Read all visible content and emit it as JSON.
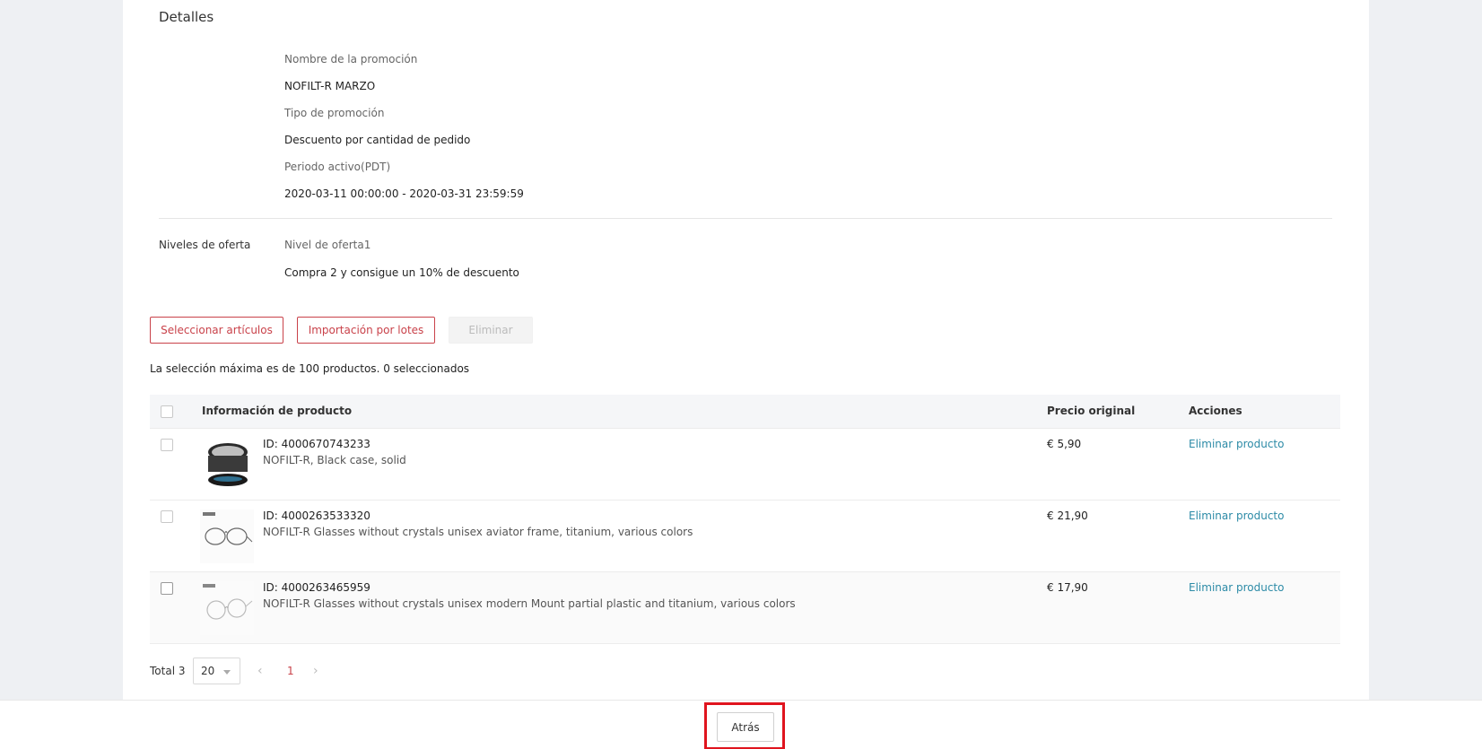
{
  "details": {
    "title": "Detalles",
    "promo_name_label": "Nombre de la promoción",
    "promo_name": "NOFILT-R MARZO",
    "promo_type_label": "Tipo de promoción",
    "promo_type": "Descuento por cantidad de pedido",
    "period_label": "Periodo activo(PDT)",
    "period": "2020-03-11 00:00:00 - 2020-03-31 23:59:59",
    "levels_label": "Niveles de oferta",
    "level_name": "Nivel de oferta1",
    "level_desc": "Compra 2 y consigue un 10% de descuento"
  },
  "actions": {
    "select_items": "Seleccionar artículos",
    "batch_import": "Importación por lotes",
    "delete": "Eliminar"
  },
  "selection_note": "La selección máxima es de 100 productos. 0 seleccionados",
  "table": {
    "headers": {
      "product_info": "Información de producto",
      "original_price": "Precio original",
      "actions": "Acciones"
    },
    "rows": [
      {
        "id": "ID: 4000670743233",
        "name": "NOFILT-R, Black case, solid",
        "price": "€ 5,90",
        "action": "Eliminar producto",
        "thumb": "glasses-case-thumbnail"
      },
      {
        "id": "ID: 4000263533320",
        "name": "NOFILT-R Glasses without crystals unisex aviator frame, titanium, various colors",
        "price": "€ 21,90",
        "action": "Eliminar producto",
        "thumb": "aviator-glasses-thumbnail"
      },
      {
        "id": "ID: 4000263465959",
        "name": "NOFILT-R Glasses without crystals unisex modern Mount partial plastic and titanium, various colors",
        "price": "€ 17,90",
        "action": "Eliminar producto",
        "thumb": "round-glasses-thumbnail"
      }
    ]
  },
  "pagination": {
    "total": "Total 3",
    "page_size": "20",
    "current_page": "1",
    "prev_icon": "chevron-left-icon",
    "next_icon": "chevron-right-icon"
  },
  "footer": {
    "back_label": "Atrás"
  },
  "colors": {
    "accent": "#c9424a",
    "link": "#2d8ba7",
    "highlight": "#e0141e"
  }
}
